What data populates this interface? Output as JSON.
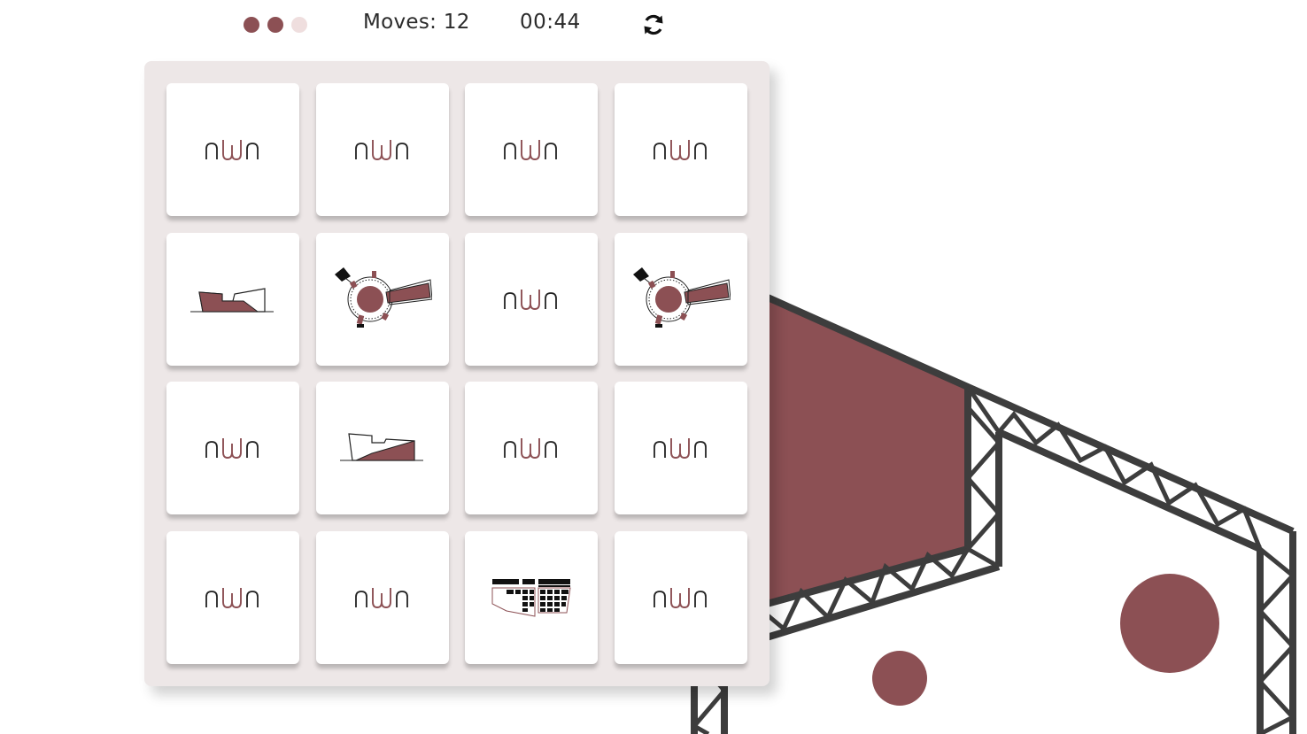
{
  "colors": {
    "accent": "#8c5054",
    "accent_light": "#efdede",
    "truss": "#3d3d3d",
    "board_bg": "#ede7e7"
  },
  "hud": {
    "stars": [
      {
        "filled": true
      },
      {
        "filled": true
      },
      {
        "filled": false
      }
    ],
    "moves_label": "Moves: 12",
    "timer": "00:44",
    "restart_icon": "refresh-icon"
  },
  "board": {
    "rows": 4,
    "cols": 4,
    "cards": [
      {
        "state": "hidden",
        "icon": "nwn-logo"
      },
      {
        "state": "hidden",
        "icon": "nwn-logo"
      },
      {
        "state": "hidden",
        "icon": "nwn-logo"
      },
      {
        "state": "hidden",
        "icon": "nwn-logo"
      },
      {
        "state": "open",
        "icon": "building-section-dark-icon"
      },
      {
        "state": "open",
        "icon": "radial-plan-icon"
      },
      {
        "state": "hidden",
        "icon": "nwn-logo"
      },
      {
        "state": "open",
        "icon": "radial-plan-icon"
      },
      {
        "state": "hidden",
        "icon": "nwn-logo"
      },
      {
        "state": "open",
        "icon": "building-section-outline-icon"
      },
      {
        "state": "hidden",
        "icon": "nwn-logo"
      },
      {
        "state": "hidden",
        "icon": "nwn-logo"
      },
      {
        "state": "hidden",
        "icon": "nwn-logo"
      },
      {
        "state": "hidden",
        "icon": "nwn-logo"
      },
      {
        "state": "open",
        "icon": "facade-grid-icon"
      },
      {
        "state": "hidden",
        "icon": "nwn-logo"
      }
    ]
  }
}
